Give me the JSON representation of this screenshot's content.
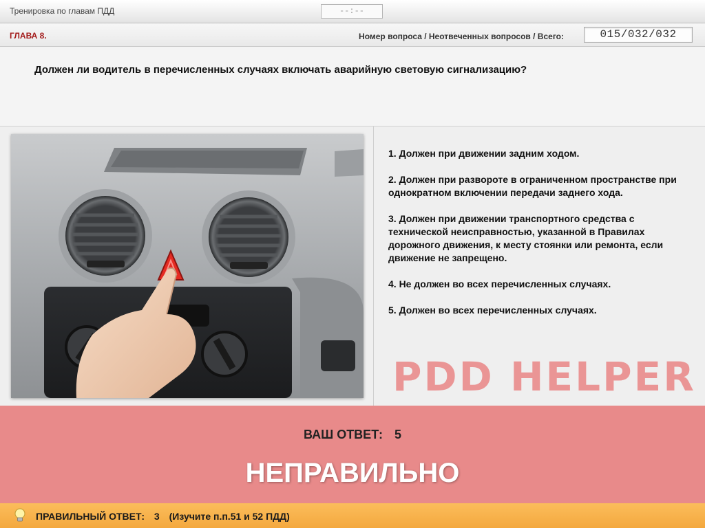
{
  "window": {
    "title": "Тренировка по главам ПДД",
    "timer": "--:--"
  },
  "chapter": {
    "label": "ГЛАВА 8.",
    "counter_label": "Номер вопроса / Неотвеченных вопросов / Всего:",
    "counter_value": "015/032/032"
  },
  "question": {
    "text": "Должен ли водитель в перечисленных случаях включать аварийную световую сигнализацию?"
  },
  "answers": [
    "1.  Должен при движении задним ходом.",
    "2.  Должен при развороте в ограниченном пространстве при однократном включении передачи заднего хода.",
    "3.  Должен при движении транспортного средства с технической неисправностью, указанной в Правилах дорожного движения, к месту стоянки или ремонта, если движение не запрещено.",
    "4.  Не должен во всех перечисленных случаях.",
    "5.  Должен во всех перечисленных случаях."
  ],
  "watermark": "PDD HELPER",
  "result": {
    "your_answer_label": "ВАШ  ОТВЕТ:",
    "your_answer_value": "5",
    "verdict": "НЕПРАВИЛЬНО",
    "color": "#e88a8a"
  },
  "correct": {
    "label": "ПРАВИЛЬНЫЙ ОТВЕТ:",
    "value": "3",
    "hint": "(Изучите п.п.51 и 52 ПДД)",
    "icon": "lightbulb-icon",
    "color": "#f4a83e"
  }
}
